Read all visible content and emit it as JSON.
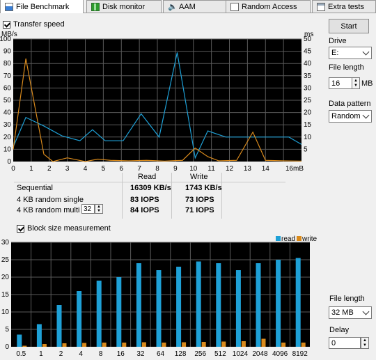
{
  "tabs": [
    {
      "label": "File Benchmark",
      "icon": "file-benchmark-icon",
      "active": true
    },
    {
      "label": "Disk monitor",
      "icon": "disk-monitor-icon",
      "active": false
    },
    {
      "label": "AAM",
      "icon": "speaker-icon",
      "active": false
    },
    {
      "label": "Random Access",
      "icon": "random-access-icon",
      "active": false
    },
    {
      "label": "Extra tests",
      "icon": "extra-tests-icon",
      "active": false
    }
  ],
  "transfer": {
    "checkbox_label": "Transfer speed",
    "left_unit": "MB/s",
    "right_unit": "ms"
  },
  "results": {
    "col_read": "Read",
    "col_write": "Write",
    "rows": [
      {
        "label": "Sequential",
        "read": "16309 KB/s",
        "write": "1743 KB/s"
      },
      {
        "label": "4 KB random single",
        "read": "83 IOPS",
        "write": "73 IOPS"
      },
      {
        "label": "4 KB random multi",
        "read": "84 IOPS",
        "write": "71 IOPS"
      }
    ],
    "multi_queue_value": "32"
  },
  "block": {
    "checkbox_label": "Block size measurement",
    "unit": "MB/s",
    "legend_read": "read",
    "legend_write": "write"
  },
  "right_panel": {
    "start_label": "Start",
    "drive_label": "Drive",
    "drive_value": "E:",
    "file_length_label": "File length",
    "file_length_value": "16",
    "file_length_unit": "MB",
    "data_pattern_label": "Data pattern",
    "data_pattern_value": "Random",
    "block_file_length_label": "File length",
    "block_file_length_value": "32 MB",
    "delay_label": "Delay",
    "delay_value": "0"
  },
  "colors": {
    "read": "#1ea0d6",
    "write": "#d98a1c",
    "grid": "#5a5a5a"
  },
  "chart_data": [
    {
      "type": "line",
      "title": "",
      "xlabel": "",
      "ylabel": "MB/s",
      "y2label": "ms",
      "x_ticks": [
        "0",
        "1",
        "2",
        "3",
        "4",
        "5",
        "6",
        "7",
        "8",
        "9",
        "10",
        "11",
        "12",
        "13",
        "14",
        "16mB"
      ],
      "y_ticks": [
        0,
        10,
        20,
        30,
        40,
        50,
        60,
        70,
        80,
        90,
        100
      ],
      "y2_ticks": [
        5,
        10,
        15,
        20,
        25,
        30,
        35,
        40,
        45,
        50
      ],
      "ylim": [
        0,
        100
      ],
      "y2lim": [
        0,
        50
      ],
      "series": [
        {
          "name": "read",
          "axis": "left",
          "x": [
            0,
            0.7,
            1.7,
            2.7,
            3.7,
            4.4,
            5.1,
            6.1,
            7.1,
            8.1,
            9.1,
            10.1,
            10.8,
            11.4,
            11.8,
            12.6,
            13.3,
            14.3,
            15.3,
            16
          ],
          "y": [
            12,
            36,
            29,
            21,
            17,
            26,
            17,
            17,
            39,
            20,
            89,
            3,
            25,
            22,
            20,
            20,
            20,
            20,
            20,
            14
          ]
        },
        {
          "name": "write",
          "axis": "right",
          "x": [
            0,
            0.7,
            1.7,
            2.2,
            3.0,
            4.0,
            4.7,
            5.4,
            6.4,
            7.4,
            8.4,
            9.4,
            10.1,
            10.8,
            11.4,
            12.4,
            13.3,
            14.0,
            15.0,
            16
          ],
          "y": [
            5,
            42,
            3,
            0,
            1.5,
            0,
            1,
            0.5,
            0.3,
            0.5,
            0.2,
            0.5,
            5.5,
            2,
            0.3,
            0.5,
            12,
            0.5,
            0.3,
            0.2
          ]
        }
      ]
    },
    {
      "type": "bar",
      "title": "",
      "xlabel": "",
      "ylabel": "MB/s",
      "categories": [
        "0.5",
        "1",
        "2",
        "4",
        "8",
        "16",
        "32",
        "64",
        "128",
        "256",
        "512",
        "1024",
        "2048",
        "4096",
        "8192"
      ],
      "y_ticks": [
        0,
        5,
        10,
        15,
        20,
        25,
        30
      ],
      "ylim": [
        0,
        30
      ],
      "legend": "top-right",
      "series": [
        {
          "name": "read",
          "values": [
            3.5,
            6.5,
            12,
            16,
            19,
            20,
            24,
            22,
            23,
            24.5,
            24,
            22,
            24,
            25,
            25.5
          ]
        },
        {
          "name": "write",
          "values": [
            0.3,
            0.8,
            1.0,
            1.1,
            1.2,
            1.2,
            1.3,
            1.2,
            1.3,
            1.4,
            1.5,
            1.6,
            2.3,
            1.2,
            1.2
          ]
        }
      ]
    }
  ]
}
